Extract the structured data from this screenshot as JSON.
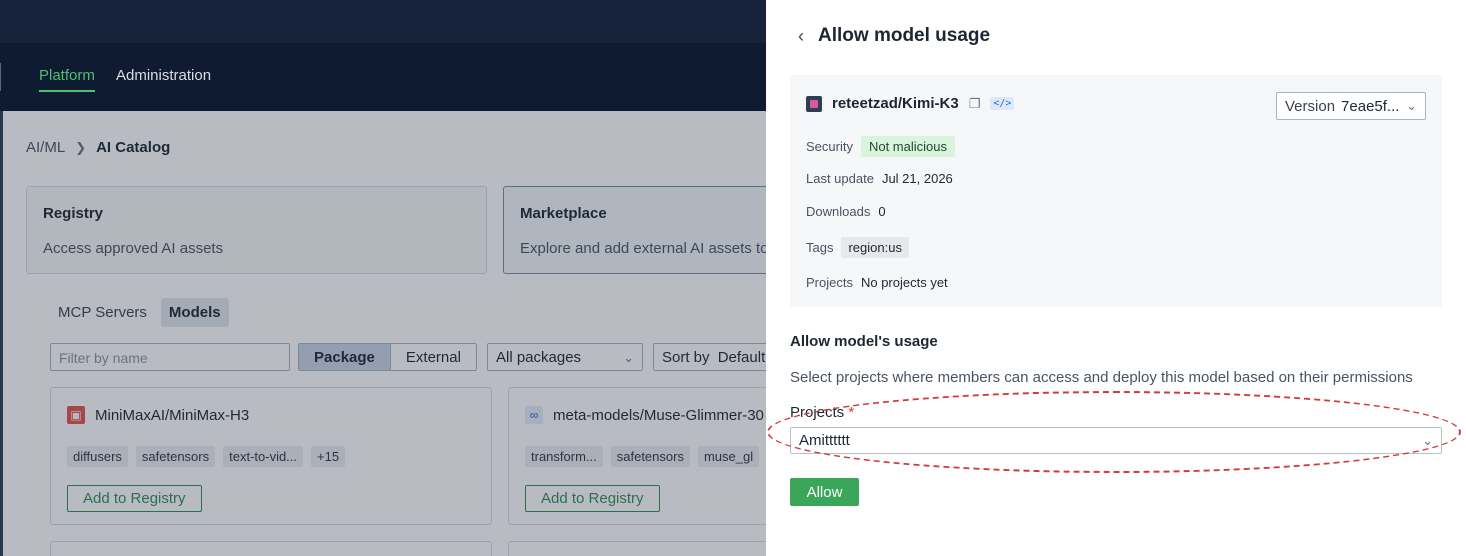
{
  "nav": {
    "items": [
      {
        "label": "Platform",
        "active": true
      },
      {
        "label": "Administration",
        "active": false
      }
    ]
  },
  "breadcrumb": {
    "parent": "AI/ML",
    "current": "AI Catalog"
  },
  "cards": {
    "registry": {
      "title": "Registry",
      "subtitle": "Access approved AI assets"
    },
    "marketplace": {
      "title": "Marketplace",
      "subtitle": "Explore and add external AI assets to"
    }
  },
  "subtabs": [
    {
      "label": "MCP Servers"
    },
    {
      "label": "Models"
    }
  ],
  "filters": {
    "filter_placeholder": "Filter by name",
    "segment": [
      "Package",
      "External"
    ],
    "packages_value": "All packages",
    "sort_label": "Sort by",
    "sort_value": "Default"
  },
  "models": [
    {
      "name": "MiniMaxAI/MiniMax-H3",
      "tags": [
        "diffusers",
        "safetensors",
        "text-to-vid...",
        "+15"
      ],
      "action": "Add to Registry"
    },
    {
      "name": "meta-models/Muse-Glimmer-30",
      "tags": [
        "transform...",
        "safetensors",
        "muse_gl"
      ],
      "action": "Add to Registry"
    }
  ],
  "panel": {
    "title": "Allow model usage",
    "model": {
      "name": "reteetzad/Kimi-K3",
      "version_label": "Version",
      "version_value": "7eae5f...",
      "security_label": "Security",
      "security_value": "Not malicious",
      "last_update_label": "Last update",
      "last_update_value": "Jul 21, 2026",
      "downloads_label": "Downloads",
      "downloads_value": "0",
      "tags_label": "Tags",
      "tags_value": "region:us",
      "projects_label": "Projects",
      "projects_value": "No projects yet"
    },
    "section_title": "Allow model's usage",
    "section_desc": "Select projects where members can access and deploy this model based on their permissions",
    "projects_field_label": "Projects",
    "required_mark": "*",
    "projects_selected": "Amitttttt",
    "allow_button": "Allow"
  },
  "colors": {
    "accent_green": "#3aa65a",
    "nav_bg": "#0f1b30",
    "highlight": "#d33b3b"
  }
}
